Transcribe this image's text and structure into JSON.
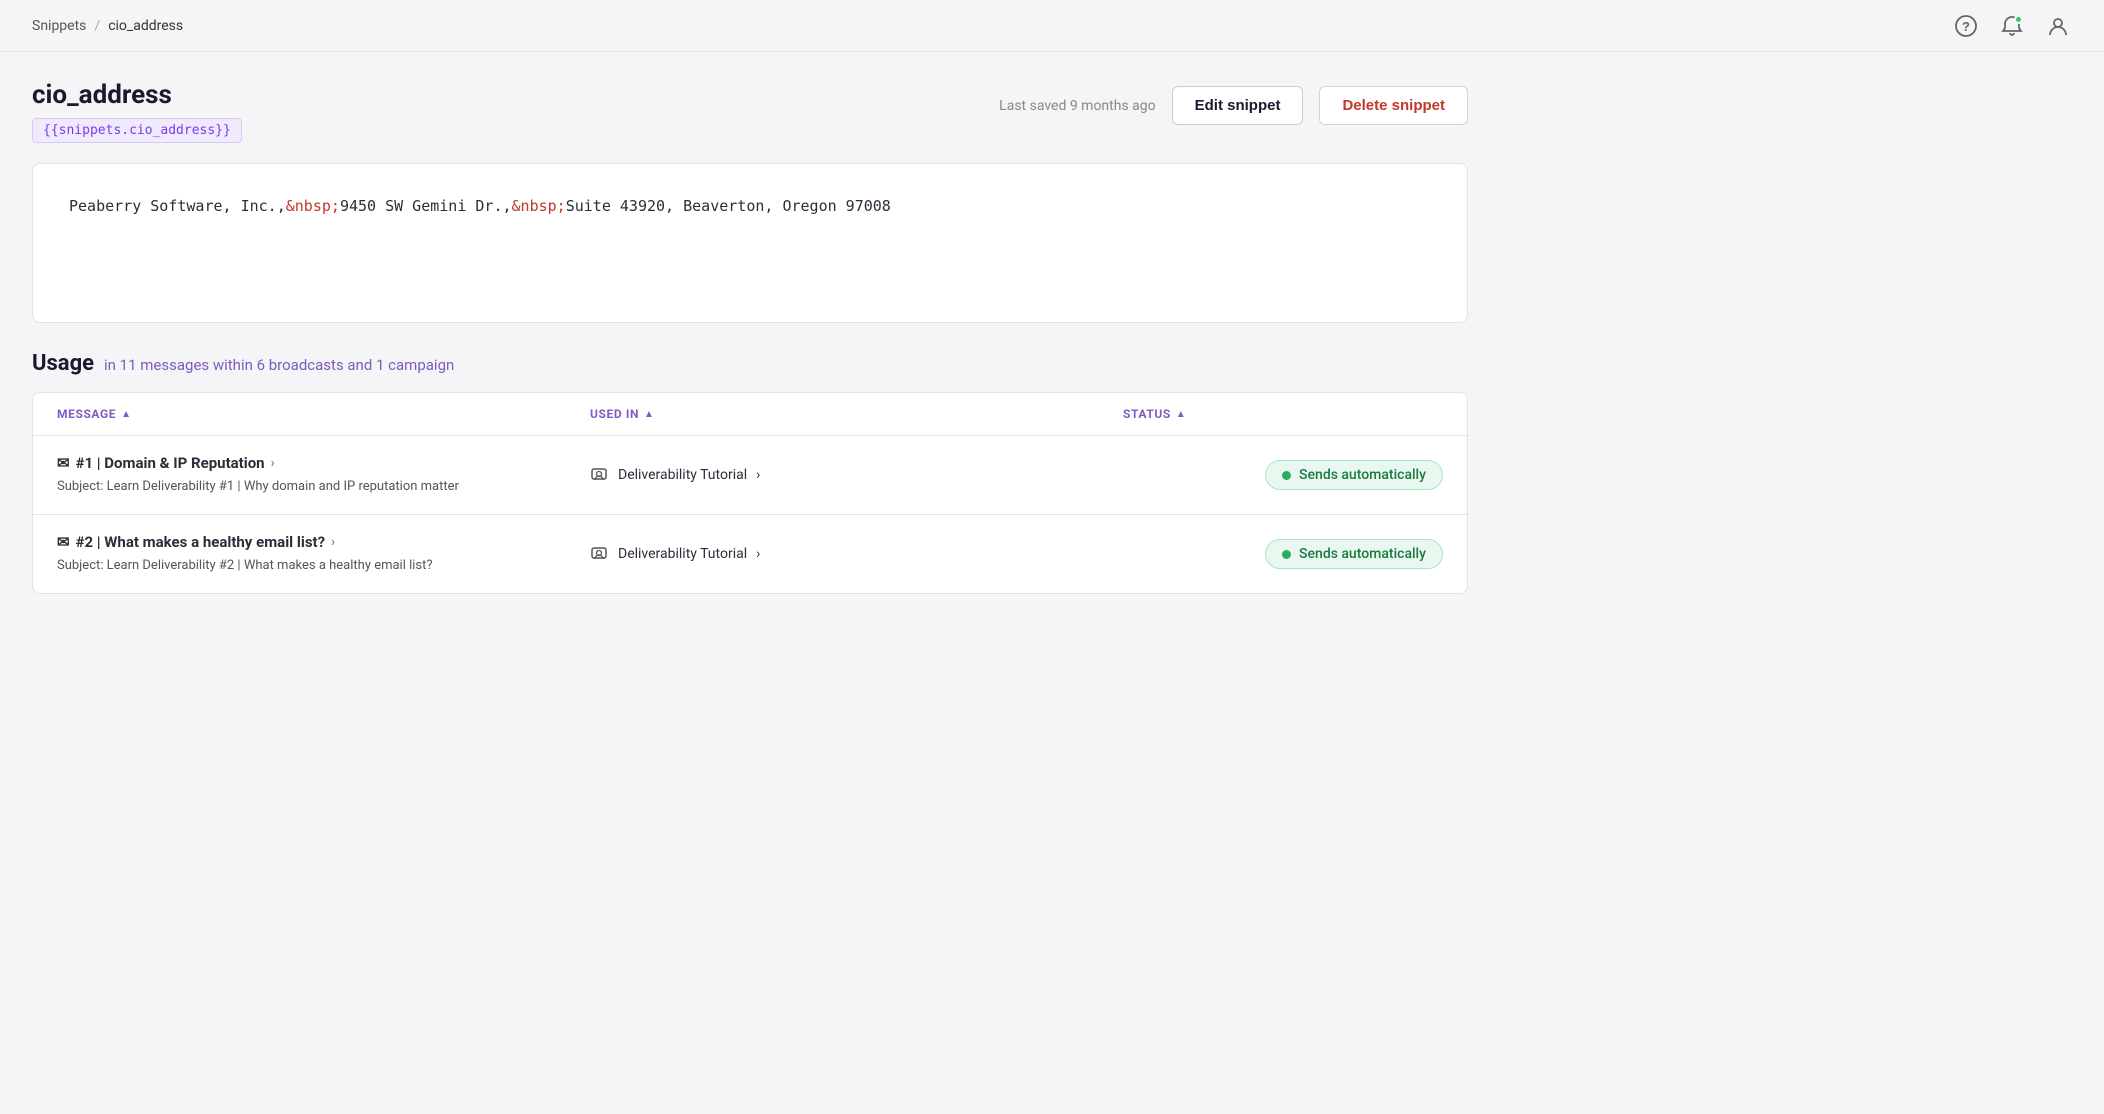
{
  "nav": {
    "breadcrumb_home": "Snippets",
    "breadcrumb_sep": "/",
    "breadcrumb_current": "cio_address",
    "help_icon": "?",
    "notif_icon": "🔔",
    "user_icon": "👤"
  },
  "page": {
    "title": "cio_address",
    "snippet_tag": "{{snippets.cio_address}}",
    "last_saved": "Last saved 9 months ago",
    "edit_button": "Edit snippet",
    "delete_button": "Delete snippet"
  },
  "preview": {
    "text_before1": "Peaberry Software, Inc.,",
    "highlight1": "&nbsp;",
    "text_middle1": "9450 SW Gemini Dr.,",
    "highlight2": "&nbsp;",
    "text_after1": "Suite 43920, Beaverton, Oregon 97008"
  },
  "usage": {
    "title": "Usage",
    "subtitle": "in 11 messages within 6 broadcasts and 1 campaign",
    "table": {
      "col_message": "MESSAGE",
      "col_used_in": "USED IN",
      "col_status": "STATUS",
      "rows": [
        {
          "id": 1,
          "message_link": "#1 | Domain & IP Reputation",
          "subject": "Subject: Learn Deliverability #1 | Why domain and IP reputation matter",
          "used_in": "Deliverability Tutorial",
          "status": "Sends automatically"
        },
        {
          "id": 2,
          "message_link": "#2 | What makes a healthy email list?",
          "subject": "Subject: Learn Deliverability #2 | What makes a healthy email list?",
          "used_in": "Deliverability Tutorial",
          "status": "Sends automatically"
        }
      ]
    }
  }
}
